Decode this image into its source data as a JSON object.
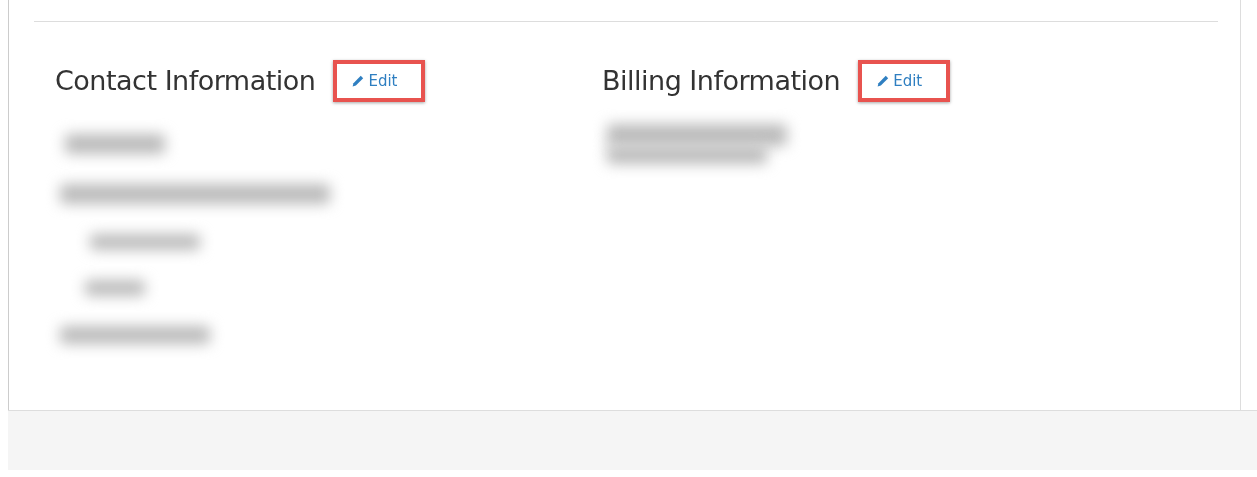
{
  "sections": [
    {
      "title": "Contact Information",
      "edit": {
        "label": "Edit",
        "highlighted": true
      }
    },
    {
      "title": "Billing Information",
      "edit": {
        "label": "Edit",
        "highlighted": true
      }
    }
  ]
}
